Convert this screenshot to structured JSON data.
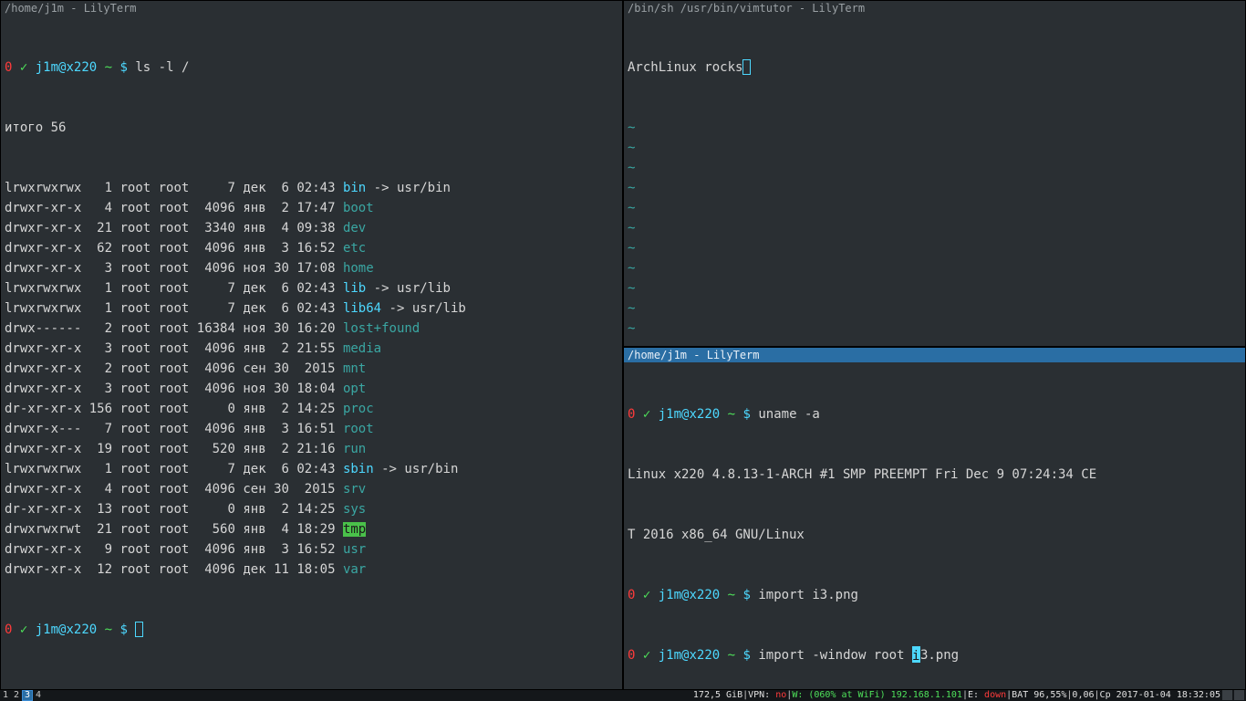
{
  "left": {
    "title": "/home/j1m - LilyTerm",
    "prompt0": "0",
    "check": "✓",
    "userhost": "j1m@x220",
    "tilde": "~",
    "dollar": "$",
    "cmd1": "ls -l /",
    "total": "итого 56",
    "ls": [
      {
        "perm": "lrwxrwxrwx",
        "n": "  1",
        "own": "root root",
        "size": "    7",
        "date": "дек  6 02:43",
        "name": "bin",
        "link": " -> usr/bin",
        "cls": "c-cyan"
      },
      {
        "perm": "drwxr-xr-x",
        "n": "  4",
        "own": "root root",
        "size": " 4096",
        "date": "янв  2 17:47",
        "name": "boot",
        "link": "",
        "cls": "c-teal"
      },
      {
        "perm": "drwxr-xr-x",
        "n": " 21",
        "own": "root root",
        "size": " 3340",
        "date": "янв  4 09:38",
        "name": "dev",
        "link": "",
        "cls": "c-teal"
      },
      {
        "perm": "drwxr-xr-x",
        "n": " 62",
        "own": "root root",
        "size": " 4096",
        "date": "янв  3 16:52",
        "name": "etc",
        "link": "",
        "cls": "c-teal"
      },
      {
        "perm": "drwxr-xr-x",
        "n": "  3",
        "own": "root root",
        "size": " 4096",
        "date": "ноя 30 17:08",
        "name": "home",
        "link": "",
        "cls": "c-teal"
      },
      {
        "perm": "lrwxrwxrwx",
        "n": "  1",
        "own": "root root",
        "size": "    7",
        "date": "дек  6 02:43",
        "name": "lib",
        "link": " -> usr/lib",
        "cls": "c-cyan"
      },
      {
        "perm": "lrwxrwxrwx",
        "n": "  1",
        "own": "root root",
        "size": "    7",
        "date": "дек  6 02:43",
        "name": "lib64",
        "link": " -> usr/lib",
        "cls": "c-cyan"
      },
      {
        "perm": "drwx------",
        "n": "  2",
        "own": "root root",
        "size": "16384",
        "date": "ноя 30 16:20",
        "name": "lost+found",
        "link": "",
        "cls": "c-teal"
      },
      {
        "perm": "drwxr-xr-x",
        "n": "  3",
        "own": "root root",
        "size": " 4096",
        "date": "янв  2 21:55",
        "name": "media",
        "link": "",
        "cls": "c-teal"
      },
      {
        "perm": "drwxr-xr-x",
        "n": "  2",
        "own": "root root",
        "size": " 4096",
        "date": "сен 30  2015",
        "name": "mnt",
        "link": "",
        "cls": "c-teal"
      },
      {
        "perm": "drwxr-xr-x",
        "n": "  3",
        "own": "root root",
        "size": " 4096",
        "date": "ноя 30 18:04",
        "name": "opt",
        "link": "",
        "cls": "c-teal"
      },
      {
        "perm": "dr-xr-xr-x",
        "n": "156",
        "own": "root root",
        "size": "    0",
        "date": "янв  2 14:25",
        "name": "proc",
        "link": "",
        "cls": "c-teal"
      },
      {
        "perm": "drwxr-x---",
        "n": "  7",
        "own": "root root",
        "size": " 4096",
        "date": "янв  3 16:51",
        "name": "root",
        "link": "",
        "cls": "c-teal"
      },
      {
        "perm": "drwxr-xr-x",
        "n": " 19",
        "own": "root root",
        "size": "  520",
        "date": "янв  2 21:16",
        "name": "run",
        "link": "",
        "cls": "c-teal"
      },
      {
        "perm": "lrwxrwxrwx",
        "n": "  1",
        "own": "root root",
        "size": "    7",
        "date": "дек  6 02:43",
        "name": "sbin",
        "link": " -> usr/bin",
        "cls": "c-cyan"
      },
      {
        "perm": "drwxr-xr-x",
        "n": "  4",
        "own": "root root",
        "size": " 4096",
        "date": "сен 30  2015",
        "name": "srv",
        "link": "",
        "cls": "c-teal"
      },
      {
        "perm": "dr-xr-xr-x",
        "n": " 13",
        "own": "root root",
        "size": "    0",
        "date": "янв  2 14:25",
        "name": "sys",
        "link": "",
        "cls": "c-teal"
      },
      {
        "perm": "drwxrwxrwt",
        "n": " 21",
        "own": "root root",
        "size": "  560",
        "date": "янв  4 18:29",
        "name": "tmp",
        "link": "",
        "cls": "bg-green"
      },
      {
        "perm": "drwxr-xr-x",
        "n": "  9",
        "own": "root root",
        "size": " 4096",
        "date": "янв  3 16:52",
        "name": "usr",
        "link": "",
        "cls": "c-teal"
      },
      {
        "perm": "drwxr-xr-x",
        "n": " 12",
        "own": "root root",
        "size": " 4096",
        "date": "дек 11 18:05",
        "name": "var",
        "link": "",
        "cls": "c-teal"
      }
    ]
  },
  "topright": {
    "title": "/bin/sh /usr/bin/vimtutor - LilyTerm",
    "line1": "ArchLinux rocks"
  },
  "bottomright": {
    "title": "/home/j1m - LilyTerm",
    "cmd1": "uname -a",
    "out1a": "Linux x220 4.8.13-1-ARCH #1 SMP PREEMPT Fri Dec 9 07:24:34 CE",
    "out1b": "T 2016 x86_64 GNU/Linux",
    "cmd2": "import i3.png",
    "cmd3a": "import -window root ",
    "cmd3cursor": "i",
    "cmd3b": "3.png"
  },
  "bar": {
    "ws": [
      "1",
      "2",
      "3",
      "4"
    ],
    "active_ws": 2,
    "disk": "172,5 GiB",
    "vpn_label": "VPN: ",
    "vpn_val": "no",
    "wifi": "W: (060% at WiFi) 192.168.1.101",
    "eth_label": "E: ",
    "eth_val": "down",
    "bat": "BAT 96,55%",
    "load": "0,06",
    "date": "Ср 2017-01-04 18:32:05"
  }
}
